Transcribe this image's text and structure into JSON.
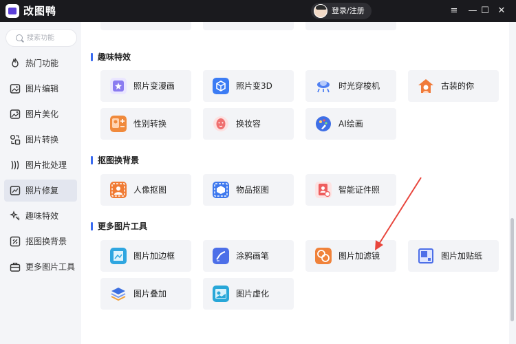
{
  "app": {
    "title": "改图鸭",
    "login": "登录/注册"
  },
  "window_controls": {
    "menu": "≡",
    "minimize": "—",
    "maximize": "☐",
    "close": "✕"
  },
  "search": {
    "placeholder": "搜索功能"
  },
  "sidebar": {
    "items": [
      {
        "label": "热门功能",
        "icon": "flame-icon"
      },
      {
        "label": "图片编辑",
        "icon": "image-edit-icon"
      },
      {
        "label": "图片美化",
        "icon": "image-beautify-icon"
      },
      {
        "label": "图片转换",
        "icon": "image-convert-icon"
      },
      {
        "label": "图片批处理",
        "icon": "batch-icon"
      },
      {
        "label": "照片修复",
        "icon": "photo-repair-icon",
        "active": true
      },
      {
        "label": "趣味特效",
        "icon": "sparkle-icon"
      },
      {
        "label": "抠图换背景",
        "icon": "cutout-icon"
      },
      {
        "label": "更多图片工具",
        "icon": "toolbox-icon"
      }
    ]
  },
  "sections": {
    "fun": {
      "title": "趣味特效",
      "tools": [
        {
          "label": "照片变漫画",
          "icon": "cartoon-icon",
          "color": "#8a7bf0"
        },
        {
          "label": "照片变3D",
          "icon": "cube-3d-icon",
          "color": "#3c7cf4"
        },
        {
          "label": "时光穿梭机",
          "icon": "time-machine-icon",
          "color": "#4f7ff2"
        },
        {
          "label": "古装的你",
          "icon": "costume-icon",
          "color": "#f07a3a"
        },
        {
          "label": "性别转换",
          "icon": "gender-swap-icon",
          "color": "#f08a3c"
        },
        {
          "label": "换妆容",
          "icon": "makeup-icon",
          "color": "#ef7070"
        },
        {
          "label": "AI绘画",
          "icon": "ai-paint-icon",
          "color": "#3f6fe6"
        }
      ]
    },
    "cutout": {
      "title": "抠图换背景",
      "tools": [
        {
          "label": "人像抠图",
          "icon": "portrait-cutout-icon",
          "color": "#f07b34"
        },
        {
          "label": "物品抠图",
          "icon": "object-cutout-icon",
          "color": "#3d78ee"
        },
        {
          "label": "智能证件照",
          "icon": "id-photo-icon",
          "color": "#ee5d5d"
        }
      ]
    },
    "more": {
      "title": "更多图片工具",
      "tools": [
        {
          "label": "图片加边框",
          "icon": "frame-icon",
          "color": "#2fa6e0"
        },
        {
          "label": "涂鸦画笔",
          "icon": "brush-icon",
          "color": "#4d6fe8"
        },
        {
          "label": "图片加滤镜",
          "icon": "filter-icon",
          "color": "#f0823a"
        },
        {
          "label": "图片加贴纸",
          "icon": "sticker-icon",
          "color": "#4d6fe8"
        },
        {
          "label": "图片叠加",
          "icon": "layers-icon",
          "color": "#3d6fe0"
        },
        {
          "label": "图片虚化",
          "icon": "blur-icon",
          "color": "#28a7d8"
        }
      ]
    }
  },
  "colors": {
    "accent": "#3a6bf0",
    "arrow": "#e8453c",
    "active_nav": "#e3e6ef"
  }
}
